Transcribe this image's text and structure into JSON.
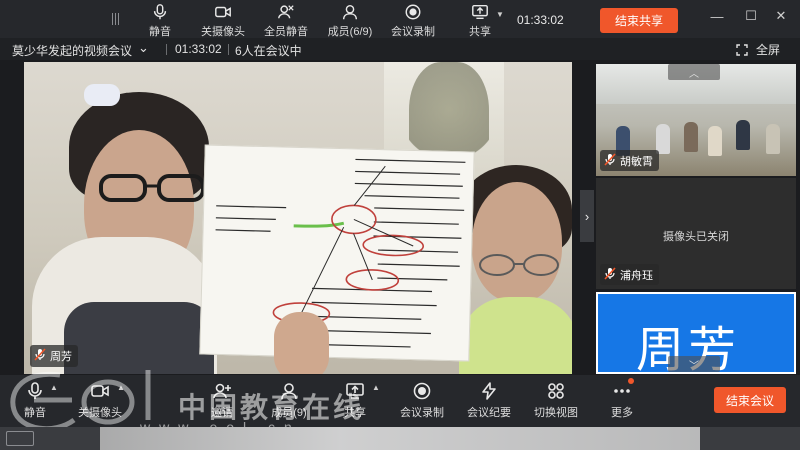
{
  "share_toolbar": {
    "items": [
      {
        "label": "静音",
        "icon": "microphone-icon"
      },
      {
        "label": "关摄像头",
        "icon": "camera-icon"
      },
      {
        "label": "全员静音",
        "icon": "mute-all-icon"
      },
      {
        "label": "成员(6/9)",
        "icon": "members-icon"
      },
      {
        "label": "会议录制",
        "icon": "record-icon"
      },
      {
        "label": "共享",
        "icon": "share-screen-icon"
      }
    ],
    "timer": "01:33:02",
    "end_share_label": "结束共享",
    "window_controls": [
      "minimize",
      "maximize",
      "close"
    ]
  },
  "meeting_bar": {
    "title": "莫少华发起的视频会议",
    "duration": "01:33:02",
    "participants_text": "6人在会议中",
    "fullscreen_label": "全屏"
  },
  "main_video": {
    "speaker_name": "周芳",
    "mic_status": "muted"
  },
  "side_panel": {
    "tiles": [
      {
        "name": "胡敏霄",
        "camera": "on",
        "mic_status": "muted"
      },
      {
        "name": "浦舟珏",
        "camera": "off",
        "off_text": "摄像头已关闭",
        "mic_status": "muted"
      },
      {
        "name": "周芳",
        "avatar_text": "周芳",
        "active": true,
        "color": "#1677e6"
      }
    ]
  },
  "bottom_toolbar": {
    "items": [
      {
        "label": "静音",
        "icon": "microphone-icon"
      },
      {
        "label": "关摄像头",
        "icon": "camera-icon"
      },
      {
        "label": "邀请",
        "icon": "invite-icon"
      },
      {
        "label": "成员(9)",
        "icon": "members-icon"
      },
      {
        "label": "共享",
        "icon": "share-screen-icon"
      },
      {
        "label": "会议录制",
        "icon": "record-icon"
      },
      {
        "label": "会议纪要",
        "icon": "minutes-icon"
      },
      {
        "label": "切换视图",
        "icon": "grid-view-icon"
      },
      {
        "label": "更多",
        "icon": "more-icon"
      }
    ],
    "end_meeting_label": "结束会议"
  },
  "watermark": {
    "text": "中国教育在线",
    "url": "www.eol.cn"
  },
  "colors": {
    "accent": "#f0572b",
    "active_tile": "#1677e6",
    "toolbar_bg": "#26282c"
  }
}
